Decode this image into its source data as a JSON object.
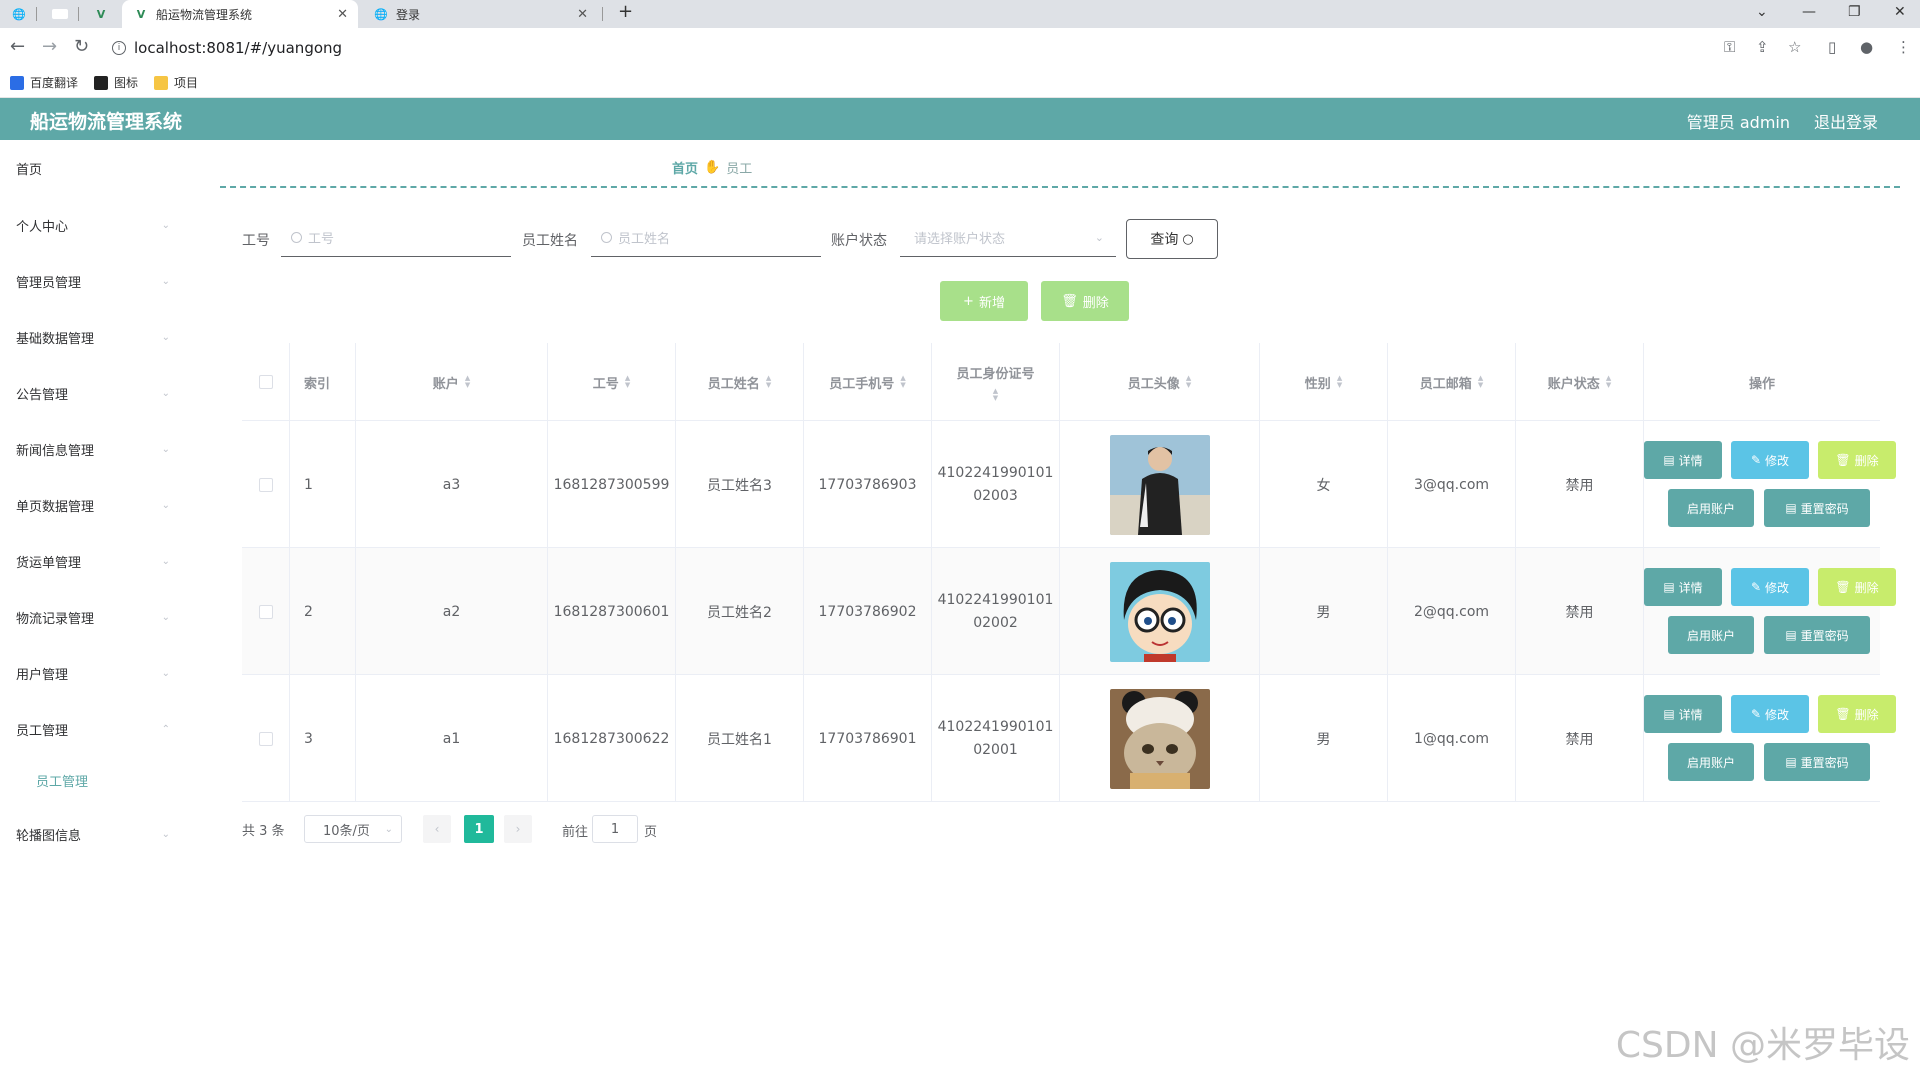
{
  "browser": {
    "tabs": [
      {
        "title": "",
        "active": false
      },
      {
        "title": "",
        "active": false
      },
      {
        "title": "",
        "active": false
      },
      {
        "title": "船运物流管理系统",
        "active": true
      },
      {
        "title": "登录",
        "active": false
      }
    ],
    "url": "localhost:8081/#/yuangong",
    "bookmarks": [
      {
        "label": "百度翻译",
        "color": "#2b6de5"
      },
      {
        "label": "图标",
        "color": "#222"
      },
      {
        "label": "项目",
        "color": "#f6c544"
      }
    ]
  },
  "header": {
    "title": "船运物流管理系统",
    "user": "管理员 admin",
    "logout": "退出登录",
    "accent": "#5ea8a7"
  },
  "sidebar": {
    "items": [
      {
        "label": "首页",
        "has_arrow": false
      },
      {
        "label": "个人中心",
        "has_arrow": true
      },
      {
        "label": "管理员管理",
        "has_arrow": true
      },
      {
        "label": "基础数据管理",
        "has_arrow": true
      },
      {
        "label": "公告管理",
        "has_arrow": true
      },
      {
        "label": "新闻信息管理",
        "has_arrow": true
      },
      {
        "label": "单页数据管理",
        "has_arrow": true
      },
      {
        "label": "货运单管理",
        "has_arrow": true
      },
      {
        "label": "物流记录管理",
        "has_arrow": true
      },
      {
        "label": "用户管理",
        "has_arrow": true
      },
      {
        "label": "员工管理",
        "has_arrow": true,
        "expanded": true
      },
      {
        "label": "轮播图信息",
        "has_arrow": true
      }
    ],
    "submenu_active": "员工管理"
  },
  "breadcrumb": {
    "home": "首页",
    "current": "员工"
  },
  "search": {
    "gonghao_label": "工号",
    "gonghao_placeholder": "工号",
    "name_label": "员工姓名",
    "name_placeholder": "员工姓名",
    "status_label": "账户状态",
    "status_placeholder": "请选择账户状态",
    "query_label": "查询"
  },
  "actions": {
    "add_label": "新增",
    "delete_label": "删除"
  },
  "table": {
    "columns": [
      "索引",
      "账户",
      "工号",
      "员工姓名",
      "员工手机号",
      "员工身份证号",
      "员工头像",
      "性别",
      "员工邮箱",
      "账户状态",
      "操作"
    ],
    "rows": [
      {
        "index": "1",
        "account": "a3",
        "gonghao": "1681287300599",
        "name": "员工姓名3",
        "phone": "17703786903",
        "id_line1": "4102241990101",
        "id_line2": "02003",
        "avatar": "person",
        "gender": "女",
        "email": "3@qq.com",
        "status": "禁用"
      },
      {
        "index": "2",
        "account": "a2",
        "gonghao": "1681287300601",
        "name": "员工姓名2",
        "phone": "17703786902",
        "id_line1": "4102241990101",
        "id_line2": "02002",
        "avatar": "cartoon",
        "gender": "男",
        "email": "2@qq.com",
        "status": "禁用"
      },
      {
        "index": "3",
        "account": "a1",
        "gonghao": "1681287300622",
        "name": "员工姓名1",
        "phone": "17703786901",
        "id_line1": "4102241990101",
        "id_line2": "02001",
        "avatar": "cat",
        "gender": "男",
        "email": "1@qq.com",
        "status": "禁用"
      }
    ],
    "op_labels": {
      "detail": "详情",
      "edit": "修改",
      "delete": "删除",
      "enable": "启用账户",
      "reset": "重置密码"
    }
  },
  "pagination": {
    "total": "共 3 条",
    "page_size": "10条/页",
    "current_page": "1",
    "goto_prefix": "前往",
    "goto_value": "1",
    "goto_suffix": "页"
  },
  "watermark": "CSDN @米罗毕设"
}
